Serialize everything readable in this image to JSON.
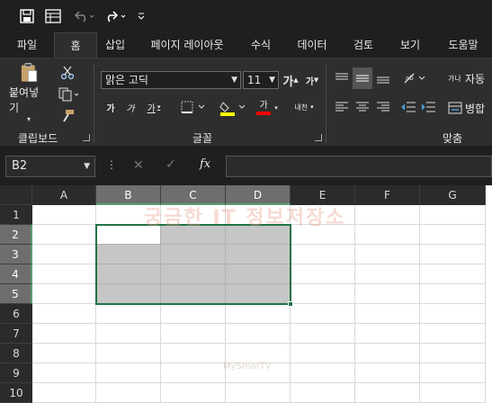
{
  "qat": {
    "icons": [
      "save-icon",
      "autosave-icon",
      "undo-icon",
      "redo-icon",
      "customize-icon"
    ]
  },
  "tabs": [
    {
      "label": "파일",
      "active": false
    },
    {
      "label": "홈",
      "active": true
    },
    {
      "label": "삽입",
      "active": false
    },
    {
      "label": "페이지 레이아웃",
      "active": false
    },
    {
      "label": "수식",
      "active": false
    },
    {
      "label": "데이터",
      "active": false
    },
    {
      "label": "검토",
      "active": false
    },
    {
      "label": "보기",
      "active": false
    },
    {
      "label": "도움말",
      "active": false
    }
  ],
  "ribbon": {
    "clipboard": {
      "paste_label": "붙여넣기",
      "group_label": "클립보드"
    },
    "font": {
      "font_name": "맑은 고딕",
      "font_size": "11",
      "grow_label": "가",
      "shrink_label": "가",
      "bold_label": "가",
      "italic_label": "가",
      "underline_label": "가",
      "font_color_label": "가",
      "phonetic_label": "내천",
      "group_label": "글꼴",
      "highlight_color": "#ffff00",
      "font_color": "#ff0000"
    },
    "alignment": {
      "wrap_label": "자동",
      "merge_label": "병합",
      "wrap_icon_text": "가나",
      "group_label": "맞춤"
    }
  },
  "formula_bar": {
    "name_box": "B2",
    "fx_label": "fx",
    "formula": ""
  },
  "sheet": {
    "columns": [
      "A",
      "B",
      "C",
      "D",
      "E",
      "F",
      "G"
    ],
    "rows": [
      "1",
      "2",
      "3",
      "4",
      "5",
      "6",
      "7",
      "8",
      "9",
      "10"
    ],
    "selected_range": "B2:D5",
    "active_cell": "B2",
    "accent": "#217346"
  },
  "watermark": {
    "main": "궁금한 IT 정보저장소",
    "sub": "MySmarTV"
  }
}
